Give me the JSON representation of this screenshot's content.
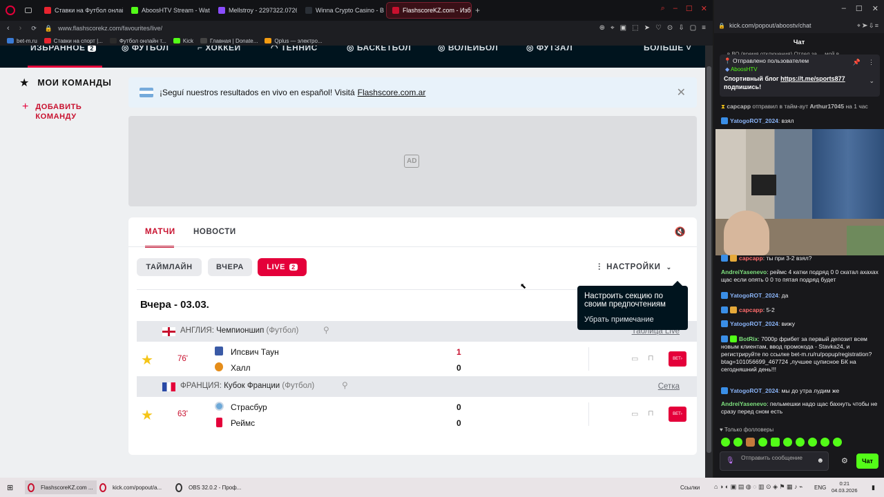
{
  "browser_left": {
    "tabs": [
      {
        "title": "Ставки на Футбол онлайн",
        "color": "#e8242f"
      },
      {
        "title": "AboosHTV Stream - Watch",
        "color": "#53fc18"
      },
      {
        "title": "Mellstroy - 2297322.0726",
        "color": "#8a4dff"
      },
      {
        "title": "Winna Crypto Casino - Be",
        "color": "#2a2f36"
      },
      {
        "title": "FlashscoreKZ.com - Избр",
        "color": "#c8102e"
      }
    ],
    "url": "www.flashscorekz.com/favourites/live/",
    "bookmarks": [
      {
        "label": "bet-m.ru",
        "color": "#3a7bd5"
      },
      {
        "label": "Ставки на спорт |...",
        "color": "#e8242f"
      },
      {
        "label": "Футбол онлайн т...",
        "color": "#2b2b2b"
      },
      {
        "label": "Kick",
        "color": "#53fc18"
      },
      {
        "label": "Главная | Donate...",
        "color": "#444"
      },
      {
        "label": "Qplus — электро...",
        "color": "#f39c12"
      }
    ]
  },
  "site": {
    "nav": [
      "ИЗБРАННОЕ",
      "ФУТБОЛ",
      "ХОККЕЙ",
      "ТЕННИС",
      "БАСКЕТБОЛ",
      "ВОЛЕЙБОЛ",
      "ФУТЗАЛ",
      "БОЛЬШЕ"
    ],
    "sidebar": {
      "my_teams": "МОИ КОМАНДЫ",
      "add_team_line1": "ДОБАВИТЬ",
      "add_team_line2": "КОМАНДУ"
    },
    "banner": {
      "text": "¡Seguí nuestros resultados en vivo en español! Visitá",
      "link": "Flashscore.com.ar"
    },
    "ad_label": "AD",
    "tabs": {
      "matches": "МАТЧИ",
      "news": "НОВОСТИ"
    },
    "filters": {
      "timeline": "ТАЙМЛАЙН",
      "yesterday": "ВЧЕРА",
      "live": "LIVE",
      "live_count": "2",
      "settings": "НАСТРОЙКИ"
    },
    "tooltip": {
      "title": "Настроить секцию по своим предпочтениям",
      "dismiss": "Убрать примечание"
    },
    "date_heading": "Вчера - 03.03.",
    "leagues": [
      {
        "country": "АНГЛИЯ",
        "name": "Чемпионшип",
        "sport": "(Футбол)",
        "right_link": "Таблица Live",
        "flag": "england",
        "match": {
          "minute": "76'",
          "home": "Ипсвич Таун",
          "away": "Халл",
          "home_score": "1",
          "away_score": "0",
          "home_score_red": true
        }
      },
      {
        "country": "ФРАНЦИЯ",
        "name": "Кубок Франции",
        "sport": "(Футбол)",
        "right_link": "Сетка",
        "flag": "france",
        "match": {
          "minute": "63'",
          "home": "Страсбур",
          "away": "Реймс",
          "home_score": "0",
          "away_score": "0",
          "home_score_red": false
        }
      }
    ],
    "bet_label": "BET",
    "accent": "#e4003a"
  },
  "browser_right": {
    "url": "kick.com/popout/aboostv/chat",
    "chat_title": "Чат",
    "pinned": {
      "header": "Отправлено пользователем",
      "author": "AboosHTV",
      "text": "Спортивный блог",
      "link": "https://t.me/sports877",
      "text2": "подпишись!"
    },
    "timeout_notice": {
      "who": "сарсарр",
      "text": "отправил в тайм-аут",
      "target": "Arthur17045",
      "duration": "на 1 час"
    },
    "messages": [
      {
        "user": "YatogoROT_2024",
        "text": "взял",
        "color": "#8ab4f8"
      },
      {
        "user": "сарсарр",
        "text": "ты при 3-2 взял?",
        "color": "#ff6b6b"
      },
      {
        "user": "AndreiYasenevo",
        "text": "реймс 4 катки подряд 0 0 скатал ахахах щас если опять 0 0 то пятая подряд будет",
        "color": "#7ee07e"
      },
      {
        "user": "YatogoROT_2024",
        "text": "да",
        "color": "#8ab4f8"
      },
      {
        "user": "сарсарр",
        "text": "5-2",
        "color": "#ff6b6b"
      },
      {
        "user": "YatogoROT_2024",
        "text": "вижу",
        "color": "#8ab4f8"
      },
      {
        "user": "BotRix",
        "text": "7000р фрибет за первый депозит всем новым клиентам, ввод промокода - Stavka24, и регистрируйте по ссылке bet-m.ru/ru/popup/registration?btag=101056699_467724 ,лучшее цуписное БК на сегодняшний день!!!",
        "color": "#7ee07e"
      },
      {
        "user": "YatogoROT_2024",
        "text": "мы до утра лудим же",
        "color": "#8ab4f8"
      },
      {
        "user": "AndreiYasenevo",
        "text": "пельмешки надо щас бахнуть чтобы не сразу перед сном есть",
        "color": "#7ee07e"
      }
    ],
    "followers_only": "Только фолловеры",
    "input_placeholder": "Отправить сообщение",
    "send_label": "Чат",
    "top_clip": "... в ВО (время отключения) Отдел за ... мой в"
  },
  "taskbar": {
    "items": [
      {
        "label": "FlashscoreKZ.com ...",
        "color": "#c8102e"
      },
      {
        "label": "kick.com/popout/a...",
        "color": "#c8102e"
      },
      {
        "label": "OBS 32.0.2 - Проф...",
        "color": "#333"
      }
    ],
    "links_label": "Ссылки",
    "lang": "ENG",
    "time": "0:21",
    "date": "04.03.2026"
  }
}
